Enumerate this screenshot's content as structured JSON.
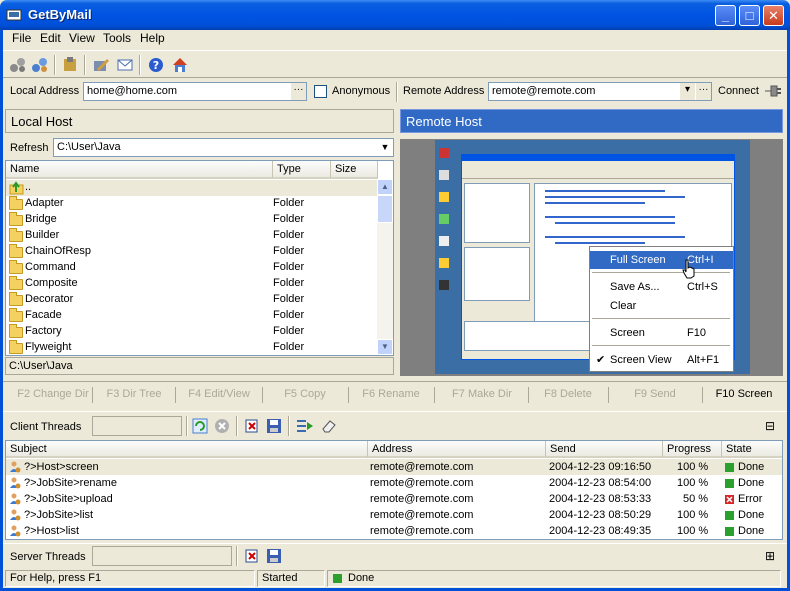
{
  "window": {
    "title": "GetByMail",
    "min": "_",
    "max": "□",
    "close": "✕"
  },
  "menu": [
    "File",
    "Edit",
    "View",
    "Tools",
    "Help"
  ],
  "address": {
    "local_label": "Local Address",
    "local_value": "home@home.com",
    "anonymous_label": "Anonymous",
    "remote_label": "Remote Address",
    "remote_value": "remote@remote.com",
    "connect_label": "Connect",
    "dots": "···"
  },
  "local": {
    "header": "Local Host",
    "refresh_label": "Refresh",
    "path": "C:\\User\\Java",
    "columns": [
      "Name",
      "Type",
      "Size"
    ],
    "parent": "..",
    "files": [
      {
        "name": "Adapter",
        "type": "Folder"
      },
      {
        "name": "Bridge",
        "type": "Folder"
      },
      {
        "name": "Builder",
        "type": "Folder"
      },
      {
        "name": "ChainOfResp",
        "type": "Folder"
      },
      {
        "name": "Command",
        "type": "Folder"
      },
      {
        "name": "Composite",
        "type": "Folder"
      },
      {
        "name": "Decorator",
        "type": "Folder"
      },
      {
        "name": "Facade",
        "type": "Folder"
      },
      {
        "name": "Factory",
        "type": "Folder"
      },
      {
        "name": "Flyweight",
        "type": "Folder"
      }
    ],
    "status_path": "C:\\User\\Java"
  },
  "remote": {
    "header": "Remote Host",
    "context_menu": [
      {
        "label": "Full Screen",
        "shortcut": "Ctrl+I"
      },
      {
        "label": "Save As...",
        "shortcut": "Ctrl+S"
      },
      {
        "label": "Clear",
        "shortcut": ""
      },
      {
        "label": "Screen",
        "shortcut": "F10"
      },
      {
        "label": "Screen View",
        "shortcut": "Alt+F1"
      }
    ]
  },
  "fkeys": [
    "F2 Change Dir",
    "F3 Dir Tree",
    "F4 Edit/View",
    "F5 Copy",
    "F6 Rename",
    "F7 Make Dir",
    "F8 Delete",
    "F9 Send",
    "F10 Screen"
  ],
  "client_threads": {
    "label": "Client Threads",
    "collapse": "⊟",
    "columns": [
      "Subject",
      "Address",
      "Send",
      "Progress",
      "State"
    ],
    "rows": [
      {
        "subject": "?>Host>screen",
        "address": "remote@remote.com",
        "send": "2004-12-23 09:16:50",
        "progress": "100 %",
        "state": "Done"
      },
      {
        "subject": "?>JobSite>rename",
        "address": "remote@remote.com",
        "send": "2004-12-23 08:54:00",
        "progress": "100 %",
        "state": "Done"
      },
      {
        "subject": "?>JobSite>upload",
        "address": "remote@remote.com",
        "send": "2004-12-23 08:53:33",
        "progress": "50 %",
        "state": "Error"
      },
      {
        "subject": "?>JobSite>list",
        "address": "remote@remote.com",
        "send": "2004-12-23 08:50:29",
        "progress": "100 %",
        "state": "Done"
      },
      {
        "subject": "?>Host>list",
        "address": "remote@remote.com",
        "send": "2004-12-23 08:49:35",
        "progress": "100 %",
        "state": "Done"
      }
    ]
  },
  "server_threads": {
    "label": "Server Threads",
    "expand": "⊞"
  },
  "statusbar": {
    "help": "For Help, press F1",
    "state": "Started",
    "done": "Done"
  },
  "colors": {
    "title": "#0054e3",
    "selection": "#316ac5",
    "done": "#2ca02c",
    "error": "#d62728"
  }
}
